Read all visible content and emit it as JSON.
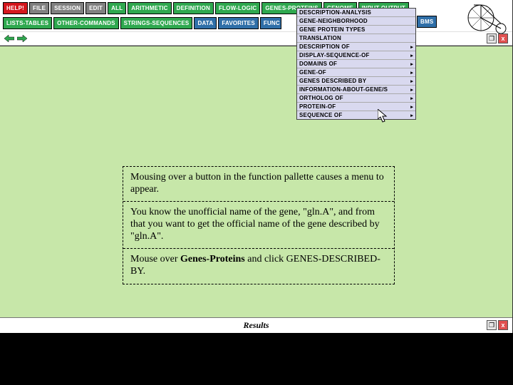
{
  "toolbar": {
    "row1": {
      "help": "HELP!",
      "file": "FILE",
      "session": "SESSION",
      "edit": "EDIT",
      "all": "ALL",
      "arithmetic": "ARITHMETIC",
      "definition": "DEFINITION",
      "flow_logic": "FLOW-LOGIC",
      "genes_proteins": "GENES-PROTEINS",
      "genome": "GENOME",
      "input_output": "INPUT-OUTPUT"
    },
    "row2": {
      "lists_tables": "LISTS-TABLES",
      "other_commands": "OTHER-COMMANDS",
      "strings_sequences": "STRINGS-SEQUENCES",
      "data": "DATA",
      "favorites": "FAVORITES",
      "func_partial": "FUNC"
    },
    "row2_hidden_tail": "BMS"
  },
  "dropdown": [
    {
      "label": "DESCRIPTION-ANALYSIS",
      "sub": ""
    },
    {
      "label": "GENE-NEIGHBORHOOD",
      "sub": ""
    },
    {
      "label": "GENE PROTEIN TYPES",
      "sub": ""
    },
    {
      "label": "TRANSLATION",
      "sub": ""
    },
    {
      "label": "DESCRIPTION OF",
      "sub": "▸"
    },
    {
      "label": "DISPLAY-SEQUENCE-OF",
      "sub": "▸"
    },
    {
      "label": "DOMAINS OF",
      "sub": "▸"
    },
    {
      "label": "GENE-OF",
      "sub": "▸"
    },
    {
      "label": "GENES DESCRIBED BY",
      "sub": "▸"
    },
    {
      "label": "INFORMATION-ABOUT-GENE/S",
      "sub": "▸"
    },
    {
      "label": "ORTHOLOG OF",
      "sub": "▸"
    },
    {
      "label": "PROTEIN-OF",
      "sub": "▸"
    },
    {
      "label": "SEQUENCE OF",
      "sub": "▸"
    }
  ],
  "tips": {
    "p1": "Mousing over a button in the function pallette causes a menu to appear.",
    "p2_a": "You know the unofficial name of the gene, \"gln.A\", and from that you want to get the official name of the gene described by \"gln.A\".",
    "p3_a": "Mouse over ",
    "p3_b": "Genes-Proteins",
    "p3_c": " and click GENES-DESCRIBED-BY."
  },
  "results": {
    "title": "Results"
  },
  "window": {
    "close": "x",
    "restore": "❐"
  }
}
